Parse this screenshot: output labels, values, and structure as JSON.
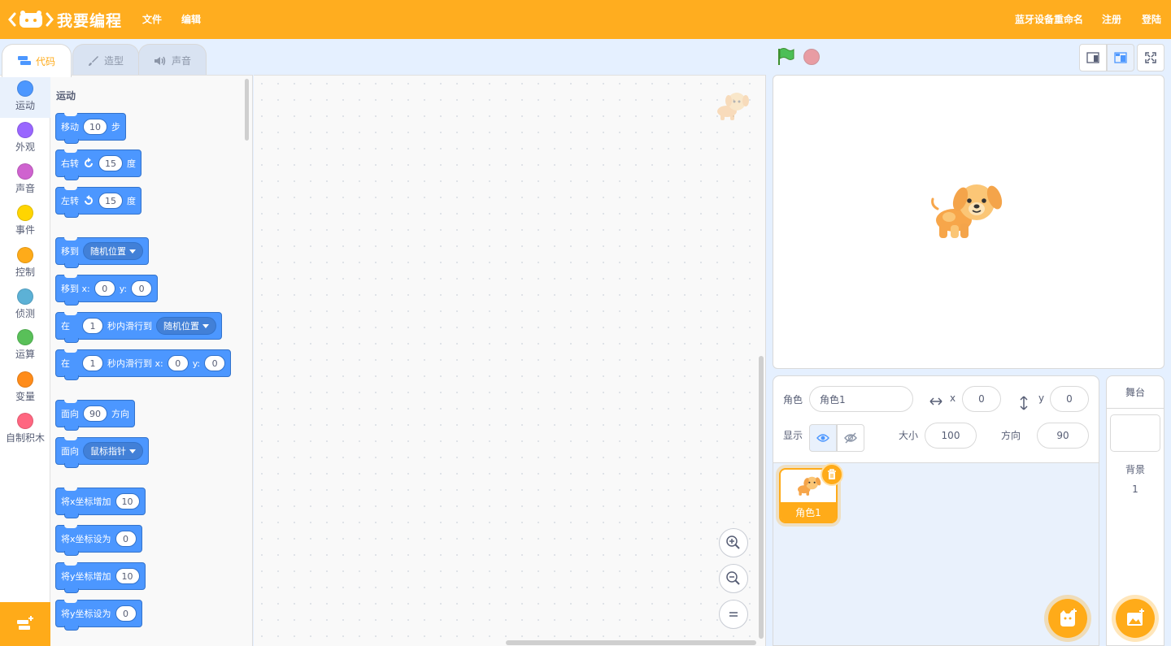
{
  "app": {
    "title": "我要编程"
  },
  "menu": {
    "file": "文件",
    "edit": "编辑",
    "bluetooth_rename": "蓝牙设备重命名",
    "register": "注册",
    "login": "登陆"
  },
  "tabs": {
    "code": "代码",
    "costumes": "造型",
    "sounds": "声音"
  },
  "categories": [
    {
      "label": "运动",
      "color": "#4c97ff"
    },
    {
      "label": "外观",
      "color": "#9966ff"
    },
    {
      "label": "声音",
      "color": "#cf63cf"
    },
    {
      "label": "事件",
      "color": "#ffd500"
    },
    {
      "label": "控制",
      "color": "#ffab19"
    },
    {
      "label": "侦测",
      "color": "#5cb1d6"
    },
    {
      "label": "运算",
      "color": "#59c059"
    },
    {
      "label": "变量",
      "color": "#ff8c1a"
    },
    {
      "label": "自制积木",
      "color": "#ff6680"
    }
  ],
  "palette": {
    "title": "运动",
    "blocks": {
      "move": {
        "t1": "移动",
        "v1": "10",
        "t2": "步"
      },
      "turn_right": {
        "t1": "右转",
        "v1": "15",
        "t2": "度"
      },
      "turn_left": {
        "t1": "左转",
        "v1": "15",
        "t2": "度"
      },
      "goto": {
        "t1": "移到",
        "d1": "随机位置"
      },
      "goto_xy": {
        "t1": "移到 x:",
        "v1": "0",
        "t2": "y:",
        "v2": "0"
      },
      "glide_to": {
        "t1": "在",
        "v1": "1",
        "t2": "秒内滑行到",
        "d1": "随机位置"
      },
      "glide_xy": {
        "t1": "在",
        "v1": "1",
        "t2": "秒内滑行到 x:",
        "v2": "0",
        "t3": "y:",
        "v3": "0"
      },
      "point_dir": {
        "t1": "面向",
        "v1": "90",
        "t2": "方向"
      },
      "point_towards": {
        "t1": "面向",
        "d1": "鼠标指针"
      },
      "change_x": {
        "t1": "将x坐标增加",
        "v1": "10"
      },
      "set_x": {
        "t1": "将x坐标设为",
        "v1": "0"
      },
      "change_y": {
        "t1": "将y坐标增加",
        "v1": "10"
      },
      "set_y": {
        "t1": "将y坐标设为",
        "v1": "0"
      }
    }
  },
  "sprite_info": {
    "sprite_label": "角色",
    "sprite_name": "角色1",
    "x_label": "x",
    "x_value": "0",
    "y_label": "y",
    "y_value": "0",
    "show_label": "显示",
    "size_label": "大小",
    "size_value": "100",
    "direction_label": "方向",
    "direction_value": "90"
  },
  "sprites": [
    {
      "name": "角色1"
    }
  ],
  "stage_panel": {
    "title": "舞台",
    "backdrop_label": "背景",
    "backdrop_count": "1"
  },
  "colors": {
    "brand": "#ffab19",
    "motion": "#4c97ff",
    "accent_bg": "#e9f1fc"
  }
}
